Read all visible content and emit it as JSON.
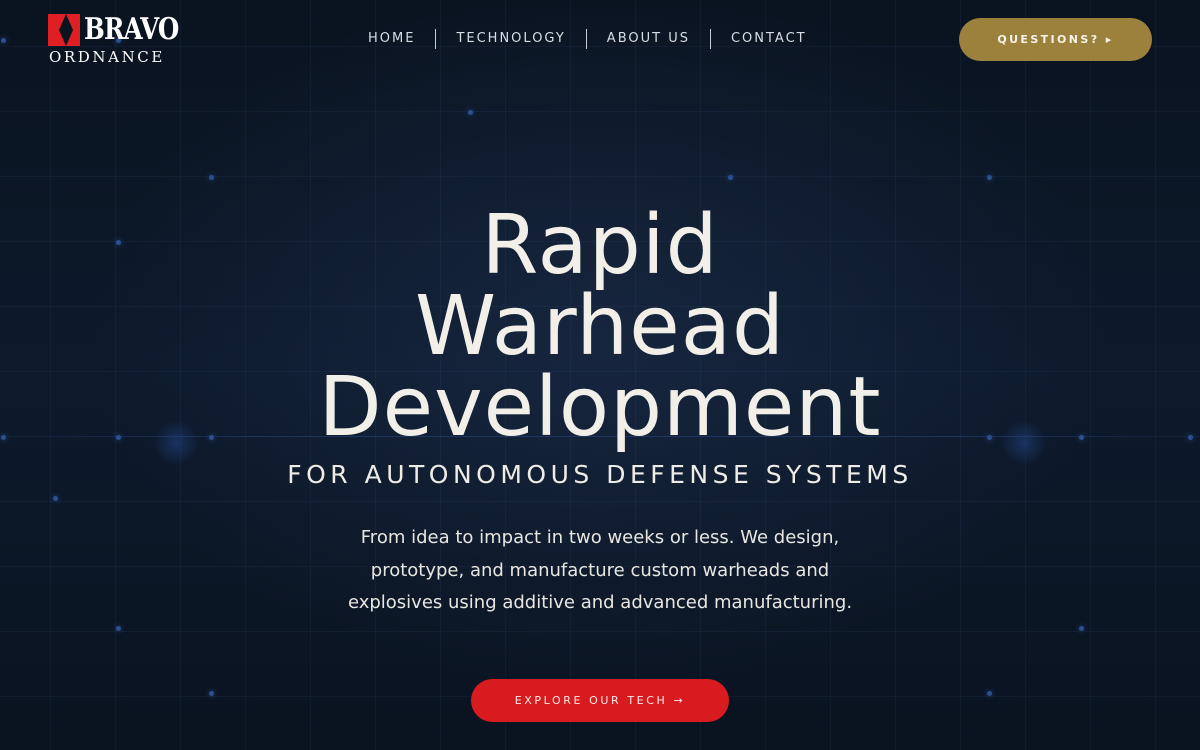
{
  "brand": {
    "name_top": "BRAVO",
    "name_bottom": "ORDNANCE",
    "logo_color": "#e01f25"
  },
  "nav": {
    "items": [
      {
        "label": "HOME"
      },
      {
        "label": "TECHNOLOGY"
      },
      {
        "label": "ABOUT US"
      },
      {
        "label": "CONTACT"
      }
    ]
  },
  "header": {
    "cta_label": "QUESTIONS? ▸",
    "cta_color": "#9c813d"
  },
  "hero": {
    "title_lines": [
      "Rapid",
      "Warhead",
      "Development"
    ],
    "subtitle": "FOR AUTONOMOUS DEFENSE SYSTEMS",
    "description": "From idea to impact in two weeks or less. We design, prototype, and manufacture custom warheads and explosives using additive and advanced manufacturing.",
    "cta_label": "EXPLORE OUR TECH →",
    "cta_color": "#d81b1e"
  },
  "colors": {
    "background": "#0b1524",
    "text": "#f2efe8"
  }
}
